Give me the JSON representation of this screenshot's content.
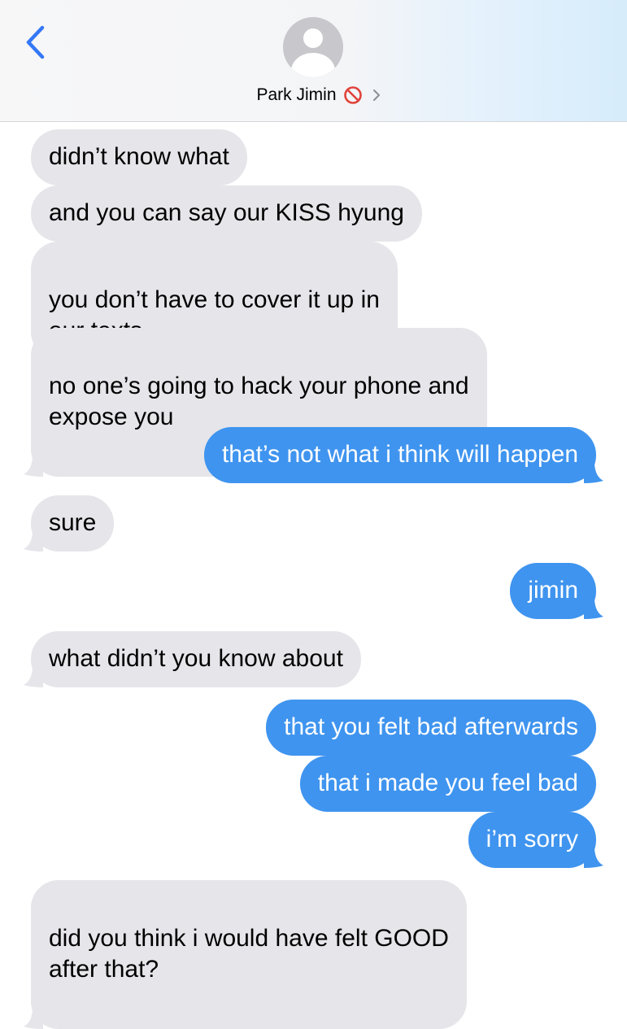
{
  "header": {
    "contact_name": "Park Jimin",
    "back_icon": "chevron-left-icon",
    "avatar_icon": "default-person-avatar",
    "status_icon": "blocked-icon",
    "more_icon": "chevron-right-icon",
    "accent_color": "#3478f6",
    "blocked_color": "#e0433b"
  },
  "colors": {
    "received_bubble": "#e5e5ea",
    "sent_bubble": "#3f94ef",
    "received_text": "#000000",
    "sent_text": "#ffffff"
  },
  "messages": [
    {
      "direction": "received",
      "text": "didn’t know what"
    },
    {
      "direction": "received",
      "text": "and you can say our KISS hyung"
    },
    {
      "direction": "received",
      "text": "you don’t have to cover it up in\nour texts"
    },
    {
      "direction": "received",
      "text": "no one’s going to hack your phone and\nexpose you"
    },
    {
      "direction": "sent",
      "text": "that’s not what i think will happen"
    },
    {
      "direction": "received",
      "text": "sure"
    },
    {
      "direction": "sent",
      "text": "jimin"
    },
    {
      "direction": "received",
      "text": "what didn’t you know about"
    },
    {
      "direction": "sent",
      "text": "that you felt bad afterwards"
    },
    {
      "direction": "sent",
      "text": "that i made you feel bad"
    },
    {
      "direction": "sent",
      "text": "i’m sorry"
    },
    {
      "direction": "received",
      "text": "did you think i would have felt GOOD\nafter that?"
    }
  ]
}
